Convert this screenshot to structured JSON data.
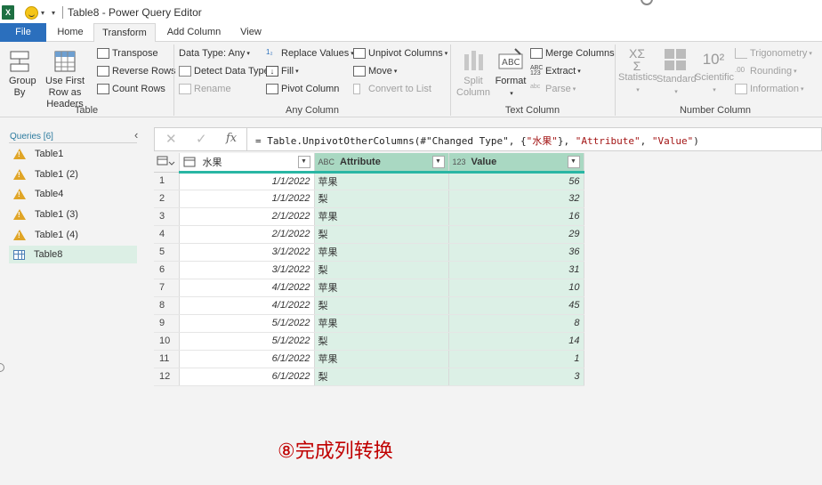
{
  "window": {
    "title": "Table8 - Power Query Editor"
  },
  "tabs": [
    {
      "label": "File"
    },
    {
      "label": "Home"
    },
    {
      "label": "Transform"
    },
    {
      "label": "Add Column"
    },
    {
      "label": "View"
    }
  ],
  "ribbon": {
    "table": {
      "label": "Table",
      "group_by": "Group By",
      "use_first_row": "Use First Row as Headers",
      "transpose": "Transpose",
      "reverse_rows": "Reverse Rows",
      "count_rows": "Count Rows"
    },
    "any_column": {
      "label": "Any Column",
      "data_type": "Data Type: Any",
      "detect_data_type": "Detect Data Type",
      "rename": "Rename",
      "replace_values": "Replace Values",
      "fill": "Fill",
      "pivot_column": "Pivot Column",
      "unpivot_columns": "Unpivot Columns",
      "move": "Move",
      "convert_to_list": "Convert to List"
    },
    "text_column": {
      "label": "Text Column",
      "split_column": "Split Column",
      "format": "Format",
      "merge_columns": "Merge Columns",
      "extract": "Extract",
      "parse": "Parse"
    },
    "number_column": {
      "label": "Number Column",
      "statistics": "Statistics",
      "standard": "Standard",
      "scientific": "Scientific",
      "trigonometry": "Trigonometry",
      "rounding": "Rounding",
      "information": "Information"
    }
  },
  "queries": {
    "header": "Queries [6]",
    "items": [
      {
        "label": "Table1",
        "icon": "warning-icon"
      },
      {
        "label": "Table1 (2)",
        "icon": "warning-icon"
      },
      {
        "label": "Table4",
        "icon": "warning-icon"
      },
      {
        "label": "Table1 (3)",
        "icon": "warning-icon"
      },
      {
        "label": "Table1 (4)",
        "icon": "warning-icon"
      },
      {
        "label": "Table8",
        "icon": "table-icon"
      }
    ]
  },
  "formula": {
    "prefix": "= Table.UnpivotOtherColumns(#\"Changed Type\", {",
    "arg1": "\"水果\"",
    "mid1": "}, ",
    "arg2": "\"Attribute\"",
    "mid2": ", ",
    "arg3": "\"Value\"",
    "suffix": ")"
  },
  "grid": {
    "columns": [
      {
        "type": "date-type-icon",
        "name": "水果"
      },
      {
        "type": "ABC",
        "name": "Attribute"
      },
      {
        "type": "123",
        "name": "Value"
      }
    ],
    "rows": [
      {
        "n": "1",
        "date": "1/1/2022",
        "attr": "苹果",
        "val": "56"
      },
      {
        "n": "2",
        "date": "1/1/2022",
        "attr": "梨",
        "val": "32"
      },
      {
        "n": "3",
        "date": "2/1/2022",
        "attr": "苹果",
        "val": "16"
      },
      {
        "n": "4",
        "date": "2/1/2022",
        "attr": "梨",
        "val": "29"
      },
      {
        "n": "5",
        "date": "3/1/2022",
        "attr": "苹果",
        "val": "36"
      },
      {
        "n": "6",
        "date": "3/1/2022",
        "attr": "梨",
        "val": "31"
      },
      {
        "n": "7",
        "date": "4/1/2022",
        "attr": "苹果",
        "val": "10"
      },
      {
        "n": "8",
        "date": "4/1/2022",
        "attr": "梨",
        "val": "45"
      },
      {
        "n": "9",
        "date": "5/1/2022",
        "attr": "苹果",
        "val": "8"
      },
      {
        "n": "10",
        "date": "5/1/2022",
        "attr": "梨",
        "val": "14"
      },
      {
        "n": "11",
        "date": "6/1/2022",
        "attr": "苹果",
        "val": "1"
      },
      {
        "n": "12",
        "date": "6/1/2022",
        "attr": "梨",
        "val": "3"
      }
    ]
  },
  "caption": "⑧完成列转换",
  "colors": {
    "accent": "#2b6fbd",
    "selected_column": "#dcf0e6",
    "header_underline": "#29b6a4",
    "caption": "#c00000"
  }
}
